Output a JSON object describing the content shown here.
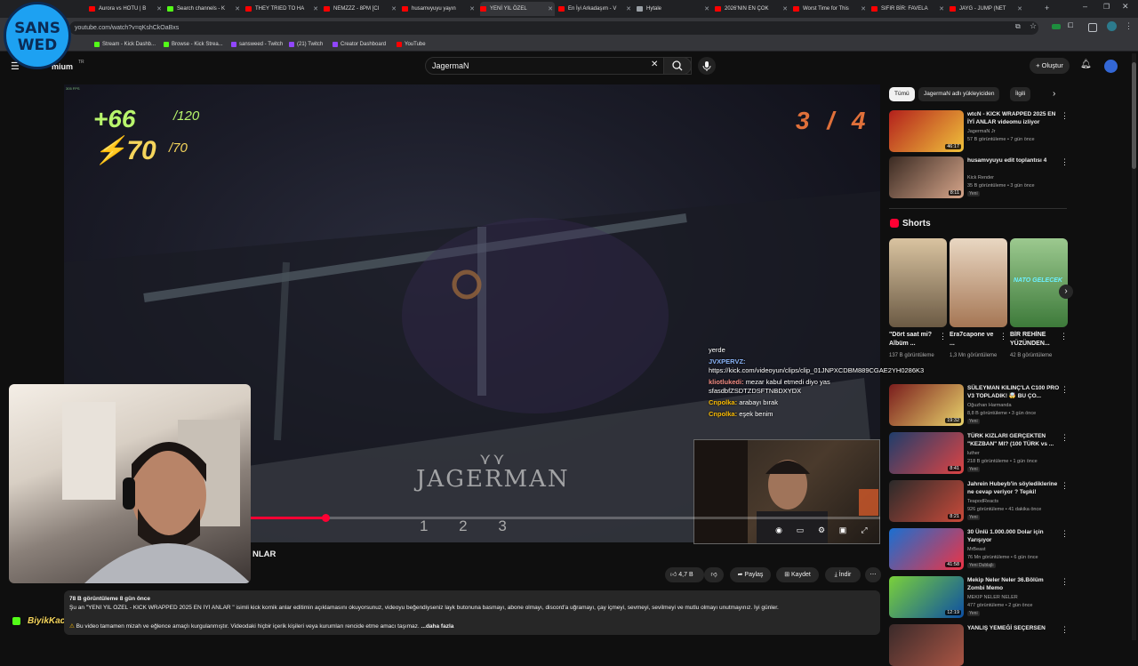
{
  "browser": {
    "tabs": [
      {
        "label": "Aurora vs HOTU | B",
        "color": "#ff0000"
      },
      {
        "label": "Search channels - K",
        "color": "#53fc18"
      },
      {
        "label": "THEY TRIED TO HA",
        "color": "#ff0000"
      },
      {
        "label": "NEMZZZ - 8PM [CI",
        "color": "#ff0000"
      },
      {
        "label": "husamvyuyu yayın",
        "color": "#ff0000"
      },
      {
        "label": "YENİ YIL ÖZEL",
        "color": "#ff0000"
      },
      {
        "label": "En İyi Arkadaşım - V",
        "color": "#ff0000"
      },
      {
        "label": "Hytale",
        "color": "#9aa0a6"
      },
      {
        "label": "2026'NIN EN ÇOK",
        "color": "#ff0000"
      },
      {
        "label": "Worst Time for This",
        "color": "#ff0000"
      },
      {
        "label": "SIFIR BİR: FAVELA",
        "color": "#ff0000"
      },
      {
        "label": "JAYG - JUMP (NET",
        "color": "#ff0000"
      }
    ],
    "url": "youtube.com/watch?v=qKshCkOaBxs",
    "bookmarks": [
      {
        "label": "Stream - Kick Dashb...",
        "color": "#53fc18"
      },
      {
        "label": "Browse - Kick Strea...",
        "color": "#53fc18"
      },
      {
        "label": "sansweed - Twitch",
        "color": "#9146ff"
      },
      {
        "label": "(21) Twitch",
        "color": "#9146ff"
      },
      {
        "label": "Creator Dashboard",
        "color": "#9146ff"
      },
      {
        "label": "YouTube",
        "color": "#ff0000"
      }
    ]
  },
  "overlay_logo": {
    "line1": "SANS",
    "line2": "WED"
  },
  "youtube": {
    "logo_suffix": "mium",
    "logo_badge": "TR",
    "search_query": "JagermaN",
    "create_label": "Oluştur"
  },
  "player": {
    "fps_label": "305 FPS",
    "health": "+66",
    "health_max": "/120",
    "armor": "70",
    "armor_max": "/70",
    "ammo": "3 / 4",
    "watermark": "JAGERMAN",
    "slots": "1 2 3",
    "progress": 0.32,
    "chat": [
      {
        "user": "",
        "text": "yerde",
        "ucolor": "#ffffff"
      },
      {
        "user": "JVXPERVZ:",
        "text": "https://kick.com/videoyun/clips/clip_01JNPXCDBM889CGAE2YH0286K3",
        "ucolor": "#8ab4f8"
      },
      {
        "user": "kliotlukedi:",
        "text": "mezar kabul etmedi diyo yas sfasdbfZSDTZDSFTNBDXYDX",
        "ucolor": "#f28b82"
      },
      {
        "user": "Cnpolka:",
        "text": "arabayı bırak",
        "ucolor": "#fbbc04"
      },
      {
        "user": "Cnpolka:",
        "text": "eşek benim",
        "ucolor": "#fbbc04"
      }
    ]
  },
  "stream_overlay": {
    "user_label": "BiyikKacakcisi",
    "suffix": "orhan"
  },
  "video": {
    "title_tail": "NLAR",
    "likes": "4,7 B",
    "share_label": "Paylaş",
    "save_label": "Kaydet",
    "download_label": "İndir",
    "views_line": "78 B görüntüleme  8 gün önce",
    "description": "Şu an \"YENİ YIL ÖZEL - KICK WRAPPED 2025 EN İYİ ANLAR \" isimli kick komik anlar editimin açıklamasını okuyorsunuz, videoyu beğendiyseniz layk butonuna basmayı, abone olmayı, discord'a uğramayı, çay içmeyi, sevmeyi, sevilmeyi ve mutlu olmayı unutmayınız. İyi günler.",
    "disclaimer": "Bu video tamamen mizah ve eğlence amaçlı kurgulanmıştır. Videodaki hiçbir içerik kişileri veya kurumları rencide etme amacı taşımaz.",
    "more_label": "...daha fazla"
  },
  "sidebar": {
    "chips": [
      "Tümü",
      "JagermaN adlı yükleyiciden",
      "İlgili"
    ],
    "shorts_title": "Shorts",
    "top_videos": [
      {
        "title": "wtcN - KICK WRAPPED 2025 EN İYİ ANLAR videomu izliyor",
        "channel": "JagermaN Jr",
        "meta": "57 B görüntüleme • 7 gün önce",
        "dur": "46:17",
        "new": "",
        "c1": "#b3201c",
        "c2": "#f0c23b"
      },
      {
        "title": "husamvyuyu edit toplantısı 4",
        "channel": "Kick Render",
        "meta": "35 B görüntüleme • 3 gün önce",
        "dur": "8:11",
        "new": "Yeni",
        "c1": "#3a2a22",
        "c2": "#d6a58a"
      }
    ],
    "shorts": [
      {
        "title": "\"Dört saat mi? Albüm ...",
        "views": "137 B görüntüleme",
        "c1": "#6b5a44",
        "c2": "#d9c3a0",
        "overlay": ""
      },
      {
        "title": "Era7capone ve ...",
        "views": "1,3 Mn görüntüleme",
        "c1": "#a57654",
        "c2": "#e9d7c2",
        "overlay": ""
      },
      {
        "title": "BİR REHİNE YÜZÜNDEN...",
        "views": "42 B görüntüleme",
        "c1": "#3d7a3a",
        "c2": "#9cc98f",
        "overlay": "NATO GELECEK"
      }
    ],
    "videos": [
      {
        "title": "SÜLEYMAN KILINÇ'LA C100 PRO V3 TOPLADIK! 🤯 BU ÇO...",
        "channel": "Oğuzhan Harmanda",
        "meta": "8,8 B görüntüleme • 3 gün önce",
        "dur": "19:32",
        "new": "Yeni",
        "c1": "#7a1d1d",
        "c2": "#e8d36b"
      },
      {
        "title": "TÜRK KIZLARI GERÇEKTEN \"KEZBAN\" MI? (100 TÜRK vs ...",
        "channel": "luther",
        "meta": "218 B görüntüleme • 1 gün önce",
        "dur": "8:41",
        "new": "Yeni",
        "c1": "#1f3d6b",
        "c2": "#d44"
      },
      {
        "title": "Jahrein Hubeyb'in söylediklerine ne cevap veriyor ? Tepki!",
        "channel": "TeapodReacts",
        "meta": "926 görüntüleme • 41 dakika önce",
        "dur": "8:21",
        "new": "Yeni",
        "c1": "#2a2a2a",
        "c2": "#c94a3a"
      },
      {
        "title": "30 Ünlü 1.000.000 Dolar için Yarışıyor",
        "channel": "MrBeast",
        "meta": "76 Mn görüntüleme • 6 gün önce",
        "dur": "41:58",
        "new": "Yeni  Dublajlı",
        "c1": "#1a6fd1",
        "c2": "#e34"
      },
      {
        "title": "Mekip Neler Neler 36.Bölüm Zombi Memo",
        "channel": "MEKIP NELER NELER",
        "meta": "477 görüntüleme • 2 gün önce",
        "dur": "12:19",
        "new": "Yeni",
        "c1": "#7ad13a",
        "c2": "#0d4fa3"
      },
      {
        "title": "YANLIŞ YEMEĞİ SEÇERSEN",
        "channel": "",
        "meta": "",
        "dur": "",
        "new": "",
        "c1": "#3a2a2a",
        "c2": "#aa5544"
      }
    ]
  }
}
